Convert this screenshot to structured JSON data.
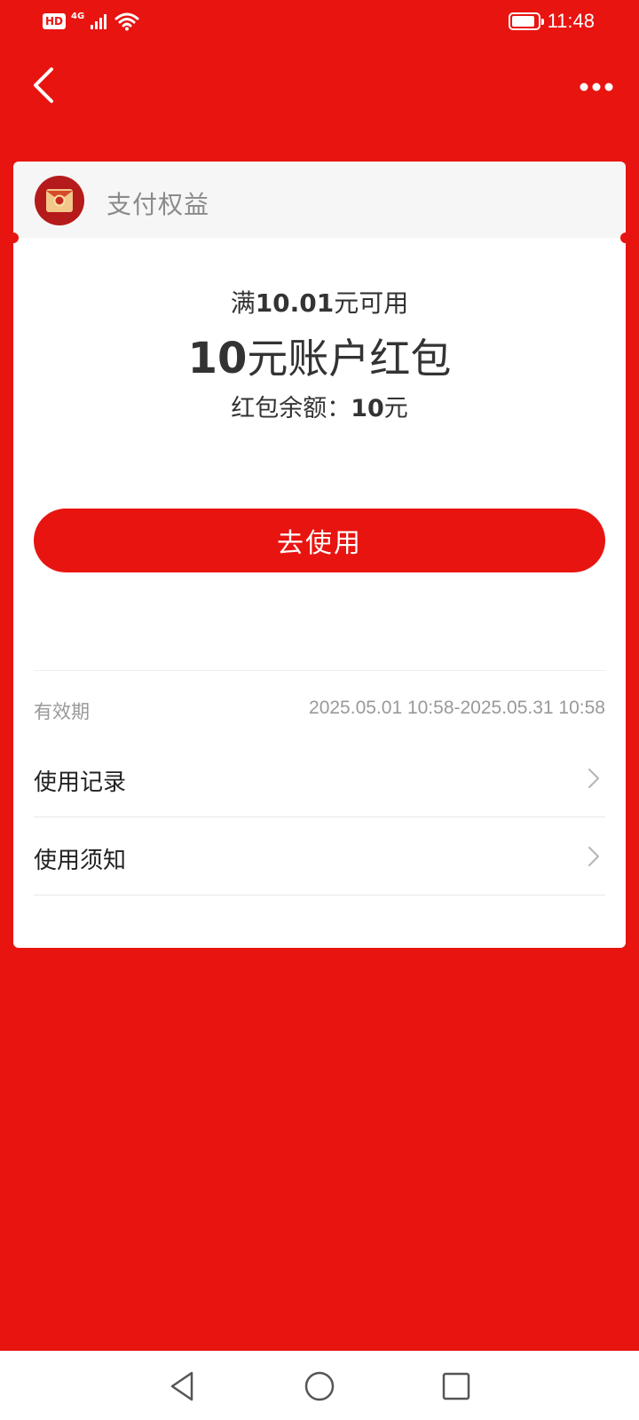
{
  "status_bar": {
    "hd": "HD",
    "network": "4G",
    "time": "11:48",
    "battery_level": 0.9
  },
  "header": {
    "title": "支付权益"
  },
  "coupon": {
    "condition_prefix": "满",
    "condition_amount": "10.01",
    "condition_suffix": "元可用",
    "name_amount": "10",
    "name_text": "元账户红包",
    "balance_label": "红包余额：",
    "balance_amount": "10",
    "balance_unit": "元",
    "use_button_label": "去使用"
  },
  "validity": {
    "label": "有效期",
    "value": "2025.05.01 10:58-2025.05.31 10:58"
  },
  "rows": [
    {
      "label": "使用记录"
    },
    {
      "label": "使用须知"
    }
  ],
  "colors": {
    "brand_red": "#e81410",
    "card_bg": "#ffffff",
    "header_bg": "#f6f6f6"
  },
  "icons": {
    "back": "back-icon",
    "more": "more-icon",
    "chevron": "chevron-right-icon",
    "red_envelope": "red-envelope-icon"
  }
}
